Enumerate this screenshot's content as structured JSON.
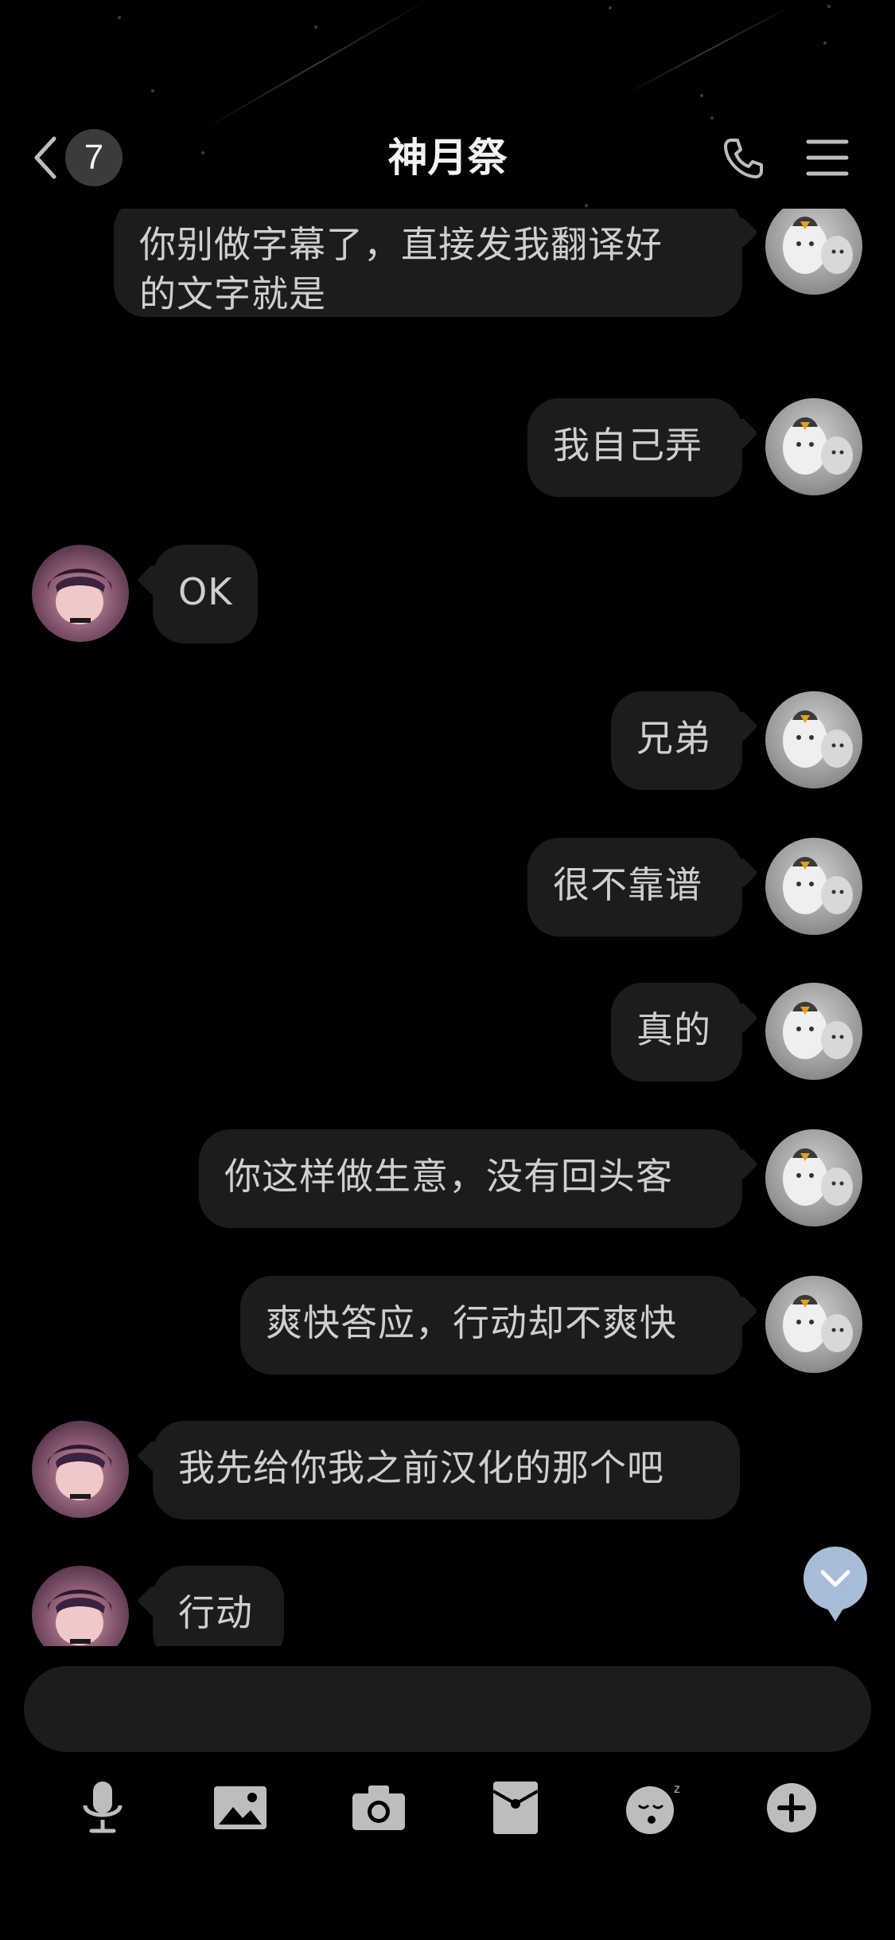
{
  "header": {
    "title": "神月祭",
    "unread_count": "7",
    "back_icon": "chevron-left-icon",
    "call_icon": "phone-icon",
    "menu_icon": "hamburger-menu-icon"
  },
  "messages": [
    {
      "side": "right",
      "text": "你别做字幕了，直接发我翻译好的文字就是",
      "line1": "你别做字幕了，直接发我翻译好",
      "line2": "的文字就是",
      "avatar": "penguin-avatar"
    },
    {
      "side": "right",
      "text": "我自己弄",
      "avatar": "penguin-avatar"
    },
    {
      "side": "left",
      "text": "OK",
      "avatar": "anime-avatar"
    },
    {
      "side": "right",
      "text": "兄弟",
      "avatar": "penguin-avatar"
    },
    {
      "side": "right",
      "text": "很不靠谱",
      "avatar": "penguin-avatar"
    },
    {
      "side": "right",
      "text": "真的",
      "avatar": "penguin-avatar"
    },
    {
      "side": "right",
      "text": "你这样做生意，没有回头客",
      "avatar": "penguin-avatar"
    },
    {
      "side": "right",
      "text": "爽快答应，行动却不爽快",
      "avatar": "penguin-avatar"
    },
    {
      "side": "left",
      "text": "我先给你我之前汉化的那个吧",
      "avatar": "anime-avatar"
    },
    {
      "side": "left",
      "text": "行动",
      "avatar": "anime-avatar"
    }
  ],
  "input": {
    "value": "",
    "placeholder": ""
  },
  "toolbar": {
    "items": [
      "microphone-icon",
      "image-icon",
      "camera-icon",
      "red-envelope-icon",
      "sticker-emoji-icon",
      "plus-icon"
    ]
  },
  "colors": {
    "background": "#000000",
    "bubble": "#1c1c1c",
    "bubble_text": "#cfcfcf",
    "scroll_fab": "#a9bcd6",
    "icon": "#bdbdbd"
  }
}
